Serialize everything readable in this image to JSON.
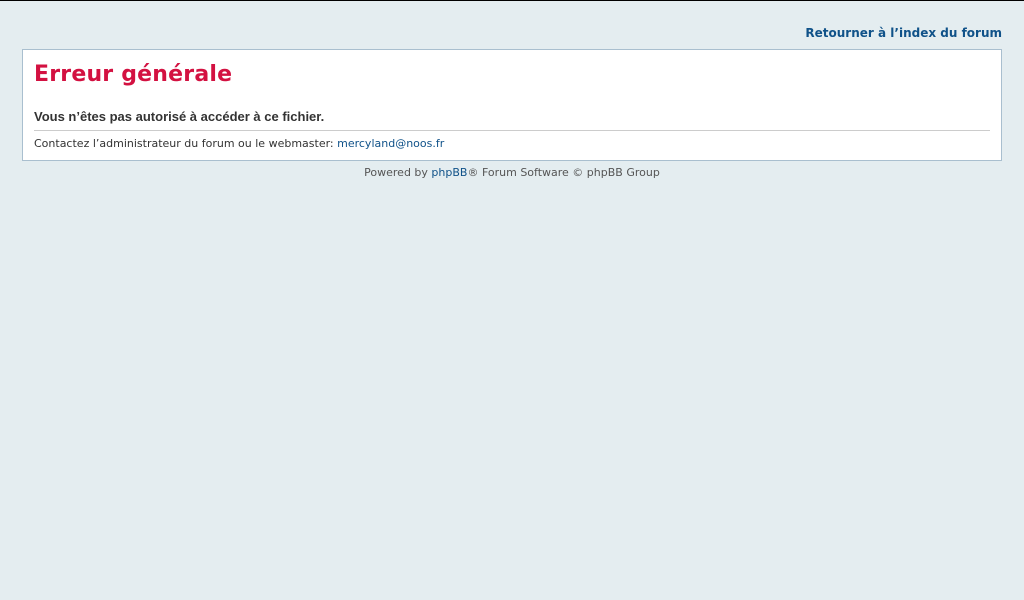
{
  "nav": {
    "return_link": "Retourner à l’index du forum"
  },
  "error": {
    "title": "Erreur générale",
    "message": "Vous n’êtes pas autorisé à accéder à ce fichier.",
    "contact_text": "Contactez l’administrateur du forum ou le webmaster: ",
    "contact_email": "mercyland@noos.fr"
  },
  "footer": {
    "powered_by_prefix": "Powered by ",
    "phpbb_link": "phpBB",
    "suffix": "® Forum Software © phpBB Group"
  },
  "colors": {
    "background": "#e4edf0",
    "title": "#d31141",
    "link": "#105289",
    "panel_border": "#a9bfcf"
  }
}
